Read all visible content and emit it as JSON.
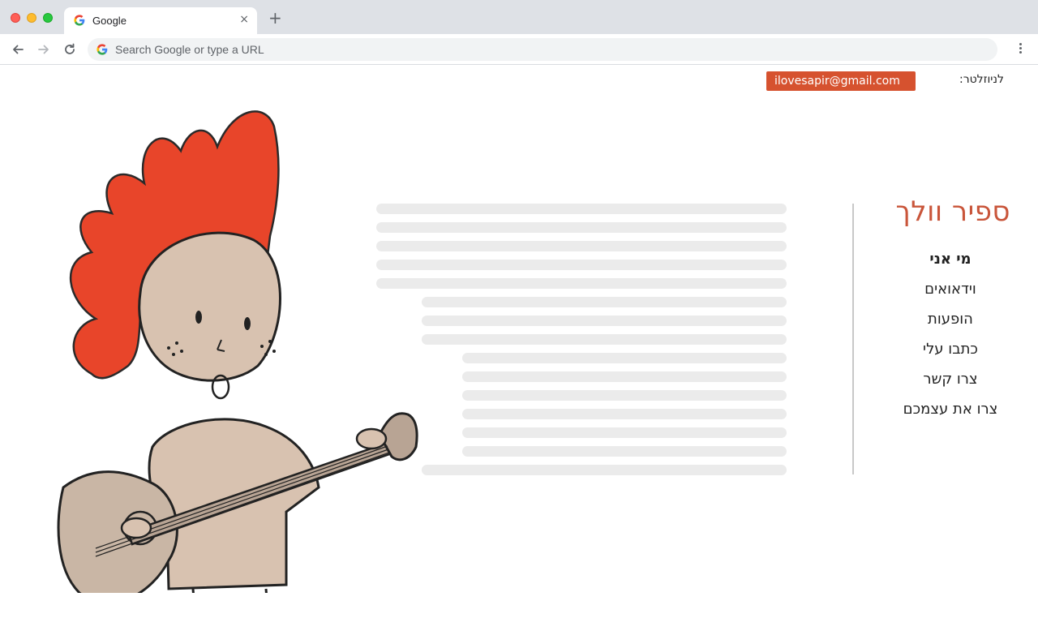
{
  "window": {
    "tab_title": "Google",
    "tab_close": "×",
    "new_tab": "+",
    "omnibox_placeholder": "Search Google or type a URL"
  },
  "page": {
    "newsletter_label": "לניוזלטר:",
    "newsletter_value": "ilovesapir@gmail.com",
    "site_title": "ספיר וולך",
    "nav": [
      {
        "label": "מי אני",
        "active": true
      },
      {
        "label": "וידאואים",
        "active": false
      },
      {
        "label": "הופעות",
        "active": false
      },
      {
        "label": "כתבו עלי",
        "active": false
      },
      {
        "label": "צרו קשר",
        "active": false
      },
      {
        "label": "צרו את עצמכם",
        "active": false
      }
    ]
  },
  "colors": {
    "accent": "#d6522f",
    "title": "#c9553a",
    "skeleton": "#ebebeb",
    "hair": "#e8452a"
  },
  "icons": {
    "back": "arrow-left-icon",
    "forward": "arrow-right-icon",
    "reload": "reload-icon",
    "menu": "kebab-menu-icon"
  }
}
